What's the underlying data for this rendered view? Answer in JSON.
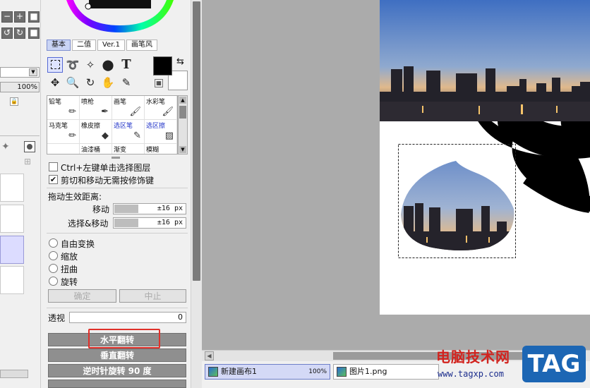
{
  "layer_panel": {
    "opacity_value": "100%"
  },
  "tool_tabs": [
    "基本",
    "二值",
    "Ver.1",
    "画笔风"
  ],
  "selection_tools": {
    "icons": [
      "rect-select-icon",
      "lasso-icon",
      "magic-wand-icon",
      "eyedropper-select-icon",
      "text-icon",
      "move-icon",
      "zoom-icon",
      "rotate-icon",
      "hand-icon",
      "color-picker-icon"
    ],
    "text_tool_glyph": "T"
  },
  "brushes": [
    {
      "label": "铅笔",
      "icon": "pencil-icon",
      "blue": false
    },
    {
      "label": "喷枪",
      "icon": "airbrush-icon",
      "blue": false
    },
    {
      "label": "画笔",
      "icon": "brush-icon",
      "blue": false
    },
    {
      "label": "水彩笔",
      "icon": "watercolor-icon",
      "blue": false
    },
    {
      "label": "马克笔",
      "icon": "marker-icon",
      "blue": false
    },
    {
      "label": "橡皮擦",
      "icon": "eraser-icon",
      "blue": false
    },
    {
      "label": "选区笔",
      "icon": "selection-pen-icon",
      "blue": true
    },
    {
      "label": "选区擦",
      "icon": "selection-eraser-icon",
      "blue": true
    },
    {
      "label": "",
      "icon": "",
      "blue": false
    },
    {
      "label": "油漆桶",
      "icon": "",
      "blue": false
    },
    {
      "label": "渐变",
      "icon": "",
      "blue": false
    },
    {
      "label": "模糊",
      "icon": "",
      "blue": false
    }
  ],
  "options": {
    "ctrl_click_label": "Ctrl+左键单击选择图层",
    "cut_move_label": "剪切和移动无需按修饰键",
    "drag_distance_title": "拖动生效距离:",
    "move_label": "移动",
    "move_value": "±16 px",
    "select_move_label": "选择&移动",
    "select_move_value": "±16 px"
  },
  "transform": {
    "free": "自由变换",
    "scale": "缩放",
    "distort": "扭曲",
    "rotate": "旋转",
    "ok": "确定",
    "cancel": "中止",
    "perspective_label": "透视",
    "perspective_value": "0",
    "flip_h": "水平翻转",
    "flip_v": "垂直翻转",
    "rotate_ccw": "逆时针旋转 90 度"
  },
  "documents": [
    {
      "name": "新建画布1",
      "zoom": "100%",
      "active": true
    },
    {
      "name": "图片1.png",
      "zoom": "",
      "active": false
    }
  ],
  "watermark": {
    "cn": "电脑技术网",
    "url": "www.tagxp.com",
    "tag": "TAG"
  },
  "colors": {
    "primary": "#000000",
    "secondary": "#ffffff",
    "highlight": "#e0302a"
  }
}
